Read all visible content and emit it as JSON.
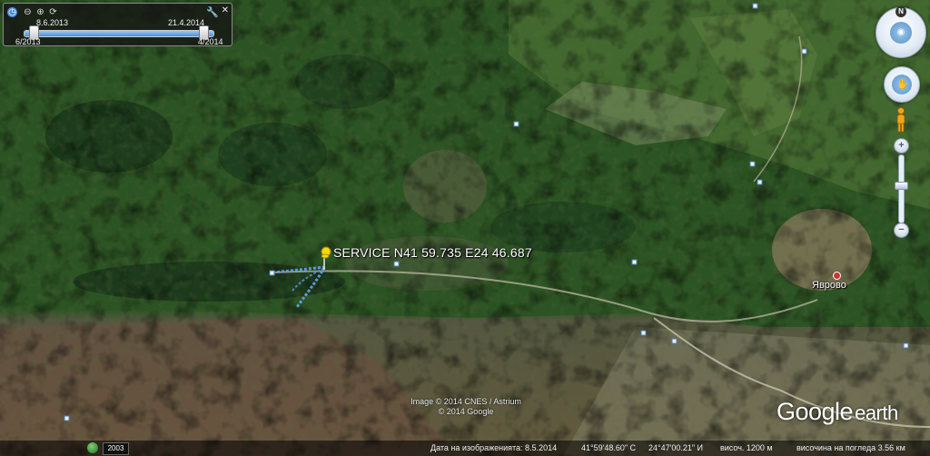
{
  "time_slider": {
    "date_left": "8.6.2013",
    "date_right": "21.4.2014",
    "range_start": "6/2013",
    "range_end": "4/2014",
    "icons": [
      "clock-icon",
      "zoom-out-icon",
      "zoom-in-icon",
      "play-icon",
      "wrench-icon",
      "close-icon"
    ]
  },
  "controls": {
    "north_label": "N"
  },
  "placemark": {
    "label": "SERVICE  N41 59.735 E24 46.687",
    "pin_color": "#f5d90a"
  },
  "village": {
    "label": "Яврово"
  },
  "imagery_credit": {
    "line1": "Image © 2014 CNES / Astrium",
    "line2": "© 2014 Google"
  },
  "logo": {
    "google": "Google",
    "earth": "earth"
  },
  "status_bar": {
    "year_badge": "2003",
    "imagery_date": "Дата на изображенията: 8.5.2014",
    "latitude": "41°59'48.60\" С",
    "longitude": "24°47'00.21\" И",
    "elevation": "височ.  1200 м",
    "eye_altitude": "височина на погледа   3.56 км"
  },
  "colors": {
    "forest_dark": "#1f3f1a",
    "forest": "#2f5b25",
    "field": "#6b7a4a",
    "track_blue": "#5a9be0"
  }
}
